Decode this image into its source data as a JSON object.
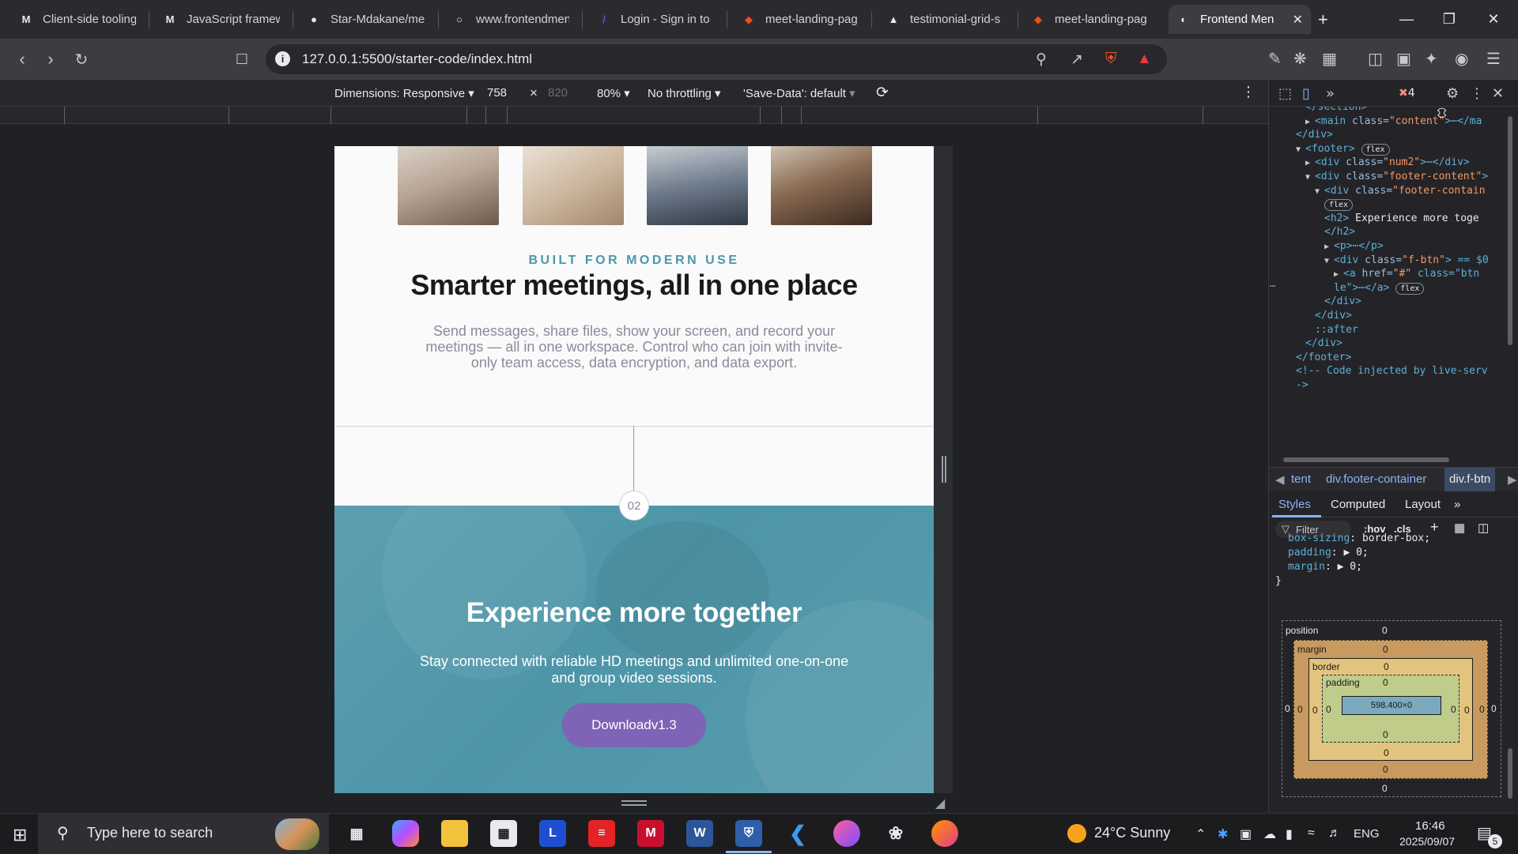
{
  "browser": {
    "tabs": [
      {
        "title": "Client-side tooling",
        "icon": "mdn-icon",
        "glyph": "M"
      },
      {
        "title": "JavaScript framew",
        "icon": "mdn-icon",
        "glyph": "M"
      },
      {
        "title": "Star-Mdakane/me",
        "icon": "github-icon",
        "glyph": "●"
      },
      {
        "title": "www.frontendmen",
        "icon": "globe-icon",
        "glyph": "○"
      },
      {
        "title": "Login - Sign in to",
        "icon": "login-icon",
        "glyph": "/"
      },
      {
        "title": "meet-landing-pag",
        "icon": "figma-icon",
        "glyph": "◆"
      },
      {
        "title": "testimonial-grid-s",
        "icon": "vercel-icon",
        "glyph": "▲"
      },
      {
        "title": "meet-landing-pag",
        "icon": "figma-icon",
        "glyph": "◆"
      },
      {
        "title": "Frontend Men",
        "icon": "frontendmentor-icon",
        "glyph": "◐"
      }
    ],
    "new_tab_glyph": "+",
    "close_tab_glyph": "✕",
    "window_controls": {
      "minimize": "—",
      "maximize": "❐",
      "close": "✕"
    },
    "url": "127.0.0.1:5500/starter-code/index.html"
  },
  "device_toolbar": {
    "dimensions_label": "Dimensions: Responsive",
    "width": "758",
    "times": "×",
    "height": "820",
    "zoom": "80%",
    "throttling": "No throttling",
    "save_data": "'Save-Data': default"
  },
  "page": {
    "eyebrow": "BUILT FOR MODERN USE",
    "headline": "Smarter meetings, all in one place",
    "description": "Send messages, share files, show your screen, and record your meetings — all in one workspace. Control who can join with invite-only team access, data encryption, and data export.",
    "step_number": "02",
    "footer_title": "Experience more together",
    "footer_text": "Stay connected with reliable HD meetings and unlimited one-on-one and group video sessions.",
    "download_button": "Downloadv1.3"
  },
  "devtools": {
    "error_count": "4",
    "dom_lines": [
      {
        "indent": 3,
        "html": "</section>",
        "plain": true
      },
      {
        "indent": 3,
        "arrow": "▶",
        "tag": "<main",
        "attr": " class=",
        "val": "\"content\"",
        "tail": ">⋯</ma"
      },
      {
        "indent": 2,
        "tag": "</div>"
      },
      {
        "indent": 2,
        "arrow": "▼",
        "tag": "<footer>",
        "pill": "flex"
      },
      {
        "indent": 3,
        "arrow": "▶",
        "tag": "<div",
        "attr": " class=",
        "val": "\"num2\"",
        "tail": ">⋯</div>"
      },
      {
        "indent": 3,
        "arrow": "▼",
        "tag": "<div",
        "attr": " class=",
        "val": "\"footer-content\"",
        "tail": ">"
      },
      {
        "indent": 4,
        "arrow": "▼",
        "tag": "<div",
        "attr": " class=",
        "val": "\"footer-contain",
        "tail": ""
      },
      {
        "indent": 5,
        "pill": "flex"
      },
      {
        "indent": 5,
        "tag": "<h2>",
        "text": " Experience more toge"
      },
      {
        "indent": 5,
        "tag": "</h2>"
      },
      {
        "indent": 5,
        "arrow": "▶",
        "tag": "<p>",
        "tail": "⋯</p>"
      },
      {
        "indent": 5,
        "arrow": "▼",
        "tag": "<div",
        "attr": " class=",
        "val": "\"f-btn\"",
        "tail": "> == $0"
      },
      {
        "indent": 6,
        "arrow": "▶",
        "tag": "<a",
        "attr": " href=",
        "val": "\"#\"",
        "tail": " class=\"btn"
      },
      {
        "indent": 6,
        "tag": "le\">⋯</a>",
        "pill": "flex"
      },
      {
        "indent": 5,
        "tag": "</div>"
      },
      {
        "indent": 4,
        "tag": "</div>"
      },
      {
        "indent": 4,
        "tag": "::after"
      },
      {
        "indent": 3,
        "tag": "</div>"
      },
      {
        "indent": 2,
        "tag": "</footer>"
      },
      {
        "indent": 2,
        "tag": "<!-- Code injected by live-serv"
      },
      {
        "indent": 2,
        "tag": "->"
      }
    ],
    "breadcrumbs": [
      "tent",
      "div.footer-container",
      "div.f-btn"
    ],
    "style_tabs": [
      "Styles",
      "Computed",
      "Layout"
    ],
    "filter_placeholder": "Filter",
    "filter_tools": [
      ":hov",
      ".cls"
    ],
    "rules": [
      {
        "prop": "box-sizing",
        "val": "border-box;"
      },
      {
        "prop": "padding",
        "val": "▶ 0;"
      },
      {
        "prop": "margin",
        "val": "▶ 0;"
      }
    ],
    "rule_close": "}",
    "box_model": {
      "position_label": "position",
      "margin_label": "margin",
      "border_label": "border",
      "padding_label": "padding",
      "content": "598.400×0",
      "zero": "0"
    }
  },
  "taskbar": {
    "search_placeholder": "Type here to search",
    "weather": "24°C  Sunny",
    "language": "ENG",
    "time": "16:46",
    "date": "2025/09/07",
    "notifications": "5"
  }
}
